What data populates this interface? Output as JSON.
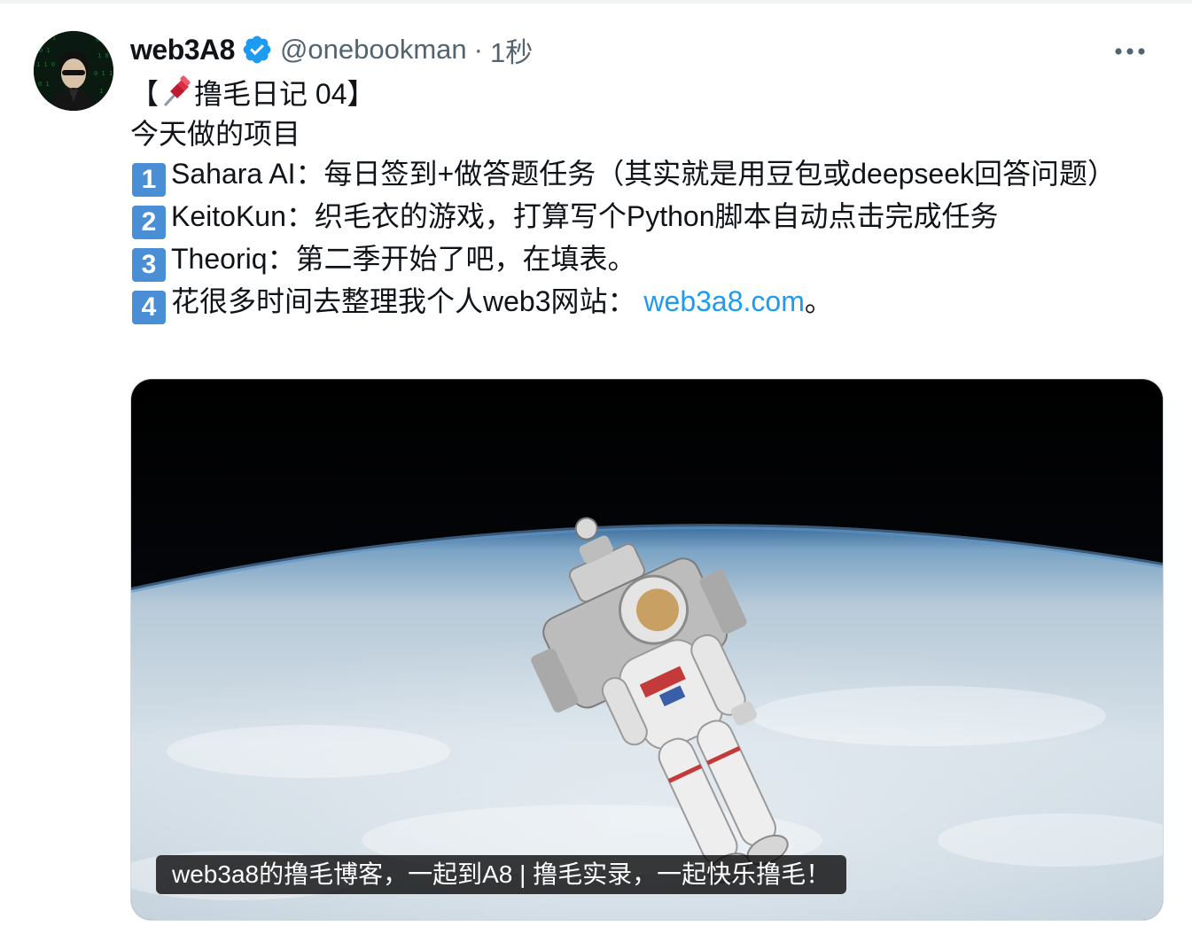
{
  "tweet": {
    "author": {
      "display_name": "web3A8",
      "handle": "@onebookman",
      "separator": "·",
      "time": "1秒",
      "verified_icon": "verified-badge-icon",
      "avatar_icon": "avatar-image"
    },
    "more_icon": "more-options-icon",
    "text": {
      "title_open": "【",
      "title_pin_icon": "pushpin-icon",
      "title_rest": "撸毛日记 04】",
      "intro": "今天做的项目",
      "items": [
        {
          "key": "1",
          "text": "Sahara AI：每日签到+做答题任务（其实就是用豆包或deepseek回答问题）"
        },
        {
          "key": "2",
          "text": "KeitoKun：织毛衣的游戏，打算写个Python脚本自动点击完成任务"
        },
        {
          "key": "3",
          "text": "Theoriq：第二季开始了吧，在填表。"
        },
        {
          "key": "4",
          "text": "花很多时间去整理我个人web3网站： ",
          "link": "web3a8.com",
          "after_link": "。"
        }
      ]
    },
    "media_card": {
      "image": "astronaut-spacewalk-earth-image",
      "caption": "web3a8的撸毛博客，一起到A8 | 撸毛实录，一起快乐撸毛！"
    },
    "colors": {
      "link": "#1d9bf0",
      "verified": "#1d9bf0",
      "secondary_text": "#536471",
      "keycap": "#4a8ed6"
    }
  }
}
